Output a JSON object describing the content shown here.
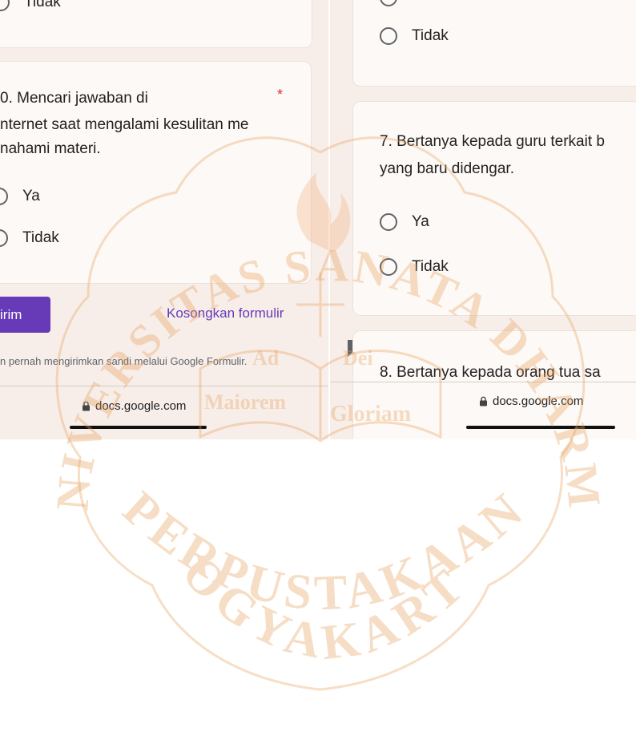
{
  "left": {
    "prev_option_label": "Tidak",
    "question": {
      "lines": [
        "0. Mencari jawaban di",
        "nternet saat mengalami kesulitan me",
        "nahami materi."
      ],
      "required_mark": "*",
      "options": [
        "Ya",
        "Tidak"
      ]
    },
    "submit_label": "irim",
    "clear_label": "Kosongkan formulir",
    "footer_note": "n pernah mengirimkan sandi melalui Google Formulir.",
    "url": "docs.google.com"
  },
  "right": {
    "prev_option_label": "Tidak",
    "question7": {
      "lines": [
        "7. Bertanya kepada guru terkait b",
        "yang baru didengar."
      ],
      "options": [
        "Ya",
        "Tidak"
      ]
    },
    "question8_text": "8. Bertanya kepada orang tua sa",
    "url": "docs.google.com"
  },
  "watermark": {
    "top_arc": "UNIVERSITAS SANATA DHARMA",
    "bottom_line1": "PERPUSTAKAAN",
    "bottom_line2": "YOGYAKARTA",
    "book_left": "Ad",
    "book_left2": "Maiorem",
    "book_right": "Dei",
    "book_right2": "Gloriam"
  },
  "colors": {
    "accent": "#673ab7",
    "required": "#d93025",
    "panel_bg": "#f7eee9"
  },
  "icons": [
    "radio-unchecked-icon",
    "lock-icon",
    "report-icon"
  ]
}
